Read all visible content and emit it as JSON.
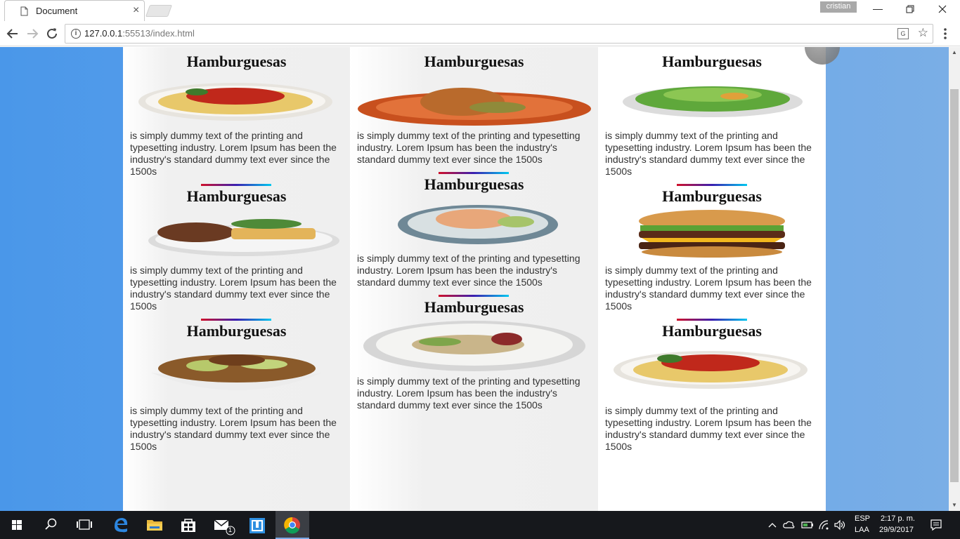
{
  "browser": {
    "tab_title": "Document",
    "profile_name": "cristian",
    "url_host": "127.0.0.1",
    "url_rest": ":55513/index.html"
  },
  "content": {
    "columns": [
      {
        "cards": [
          {
            "title": "Hamburguesas",
            "dish": "spaghetti",
            "text": "is simply dummy text of the printing and typesetting industry. Lorem Ipsum has been the industry's standard dummy text ever since the 1500s"
          },
          {
            "title": "Hamburguesas",
            "dish": "steak-fries",
            "text": "is simply dummy text of the printing and typesetting industry. Lorem Ipsum has been the industry's standard dummy text ever since the 1500s"
          },
          {
            "title": "Hamburguesas",
            "dish": "stir-fry",
            "text": "is simply dummy text of the printing and typesetting industry. Lorem Ipsum has been the industry's standard dummy text ever since the 1500s"
          }
        ]
      },
      {
        "cards": [
          {
            "title": "Hamburguesas",
            "dish": "roast-chicken",
            "text": "is simply dummy text of the printing and typesetting industry. Lorem Ipsum has been the industry's standard dummy text ever since the 1500s"
          },
          {
            "title": "Hamburguesas",
            "dish": "fish-plate",
            "text": "is simply dummy text of the printing and typesetting industry. Lorem Ipsum has been the industry's standard dummy text ever since the 1500s"
          },
          {
            "title": "Hamburguesas",
            "dish": "gourmet-plate",
            "text": "is simply dummy text of the printing and typesetting industry. Lorem Ipsum has been the industry's standard dummy text ever since the 1500s"
          }
        ]
      },
      {
        "cards": [
          {
            "title": "Hamburguesas",
            "dish": "salad",
            "text": "is simply dummy text of the printing and typesetting industry. Lorem Ipsum has been the industry's standard dummy text ever since the 1500s"
          },
          {
            "title": "Hamburguesas",
            "dish": "burger",
            "text": "is simply dummy text of the printing and typesetting industry. Lorem Ipsum has been the industry's standard dummy text ever since the 1500s"
          },
          {
            "title": "Hamburguesas",
            "dish": "spaghetti",
            "text": "is simply dummy text of the printing and typesetting industry. Lorem Ipsum has been the industry's standard dummy text ever since the 1500s"
          }
        ]
      }
    ]
  },
  "taskbar": {
    "mail_badge": "1",
    "language_line1": "ESP",
    "language_line2": "LAA",
    "time": "2:17 p. m.",
    "date": "29/9/2017"
  },
  "colors": {
    "page_bg_left": "#4a97e9",
    "page_bg_right": "#7aaee6",
    "rule_start": "#d0102a",
    "rule_mid": "#3a1fb0",
    "rule_end": "#00c8f0",
    "taskbar": "#16181c"
  }
}
